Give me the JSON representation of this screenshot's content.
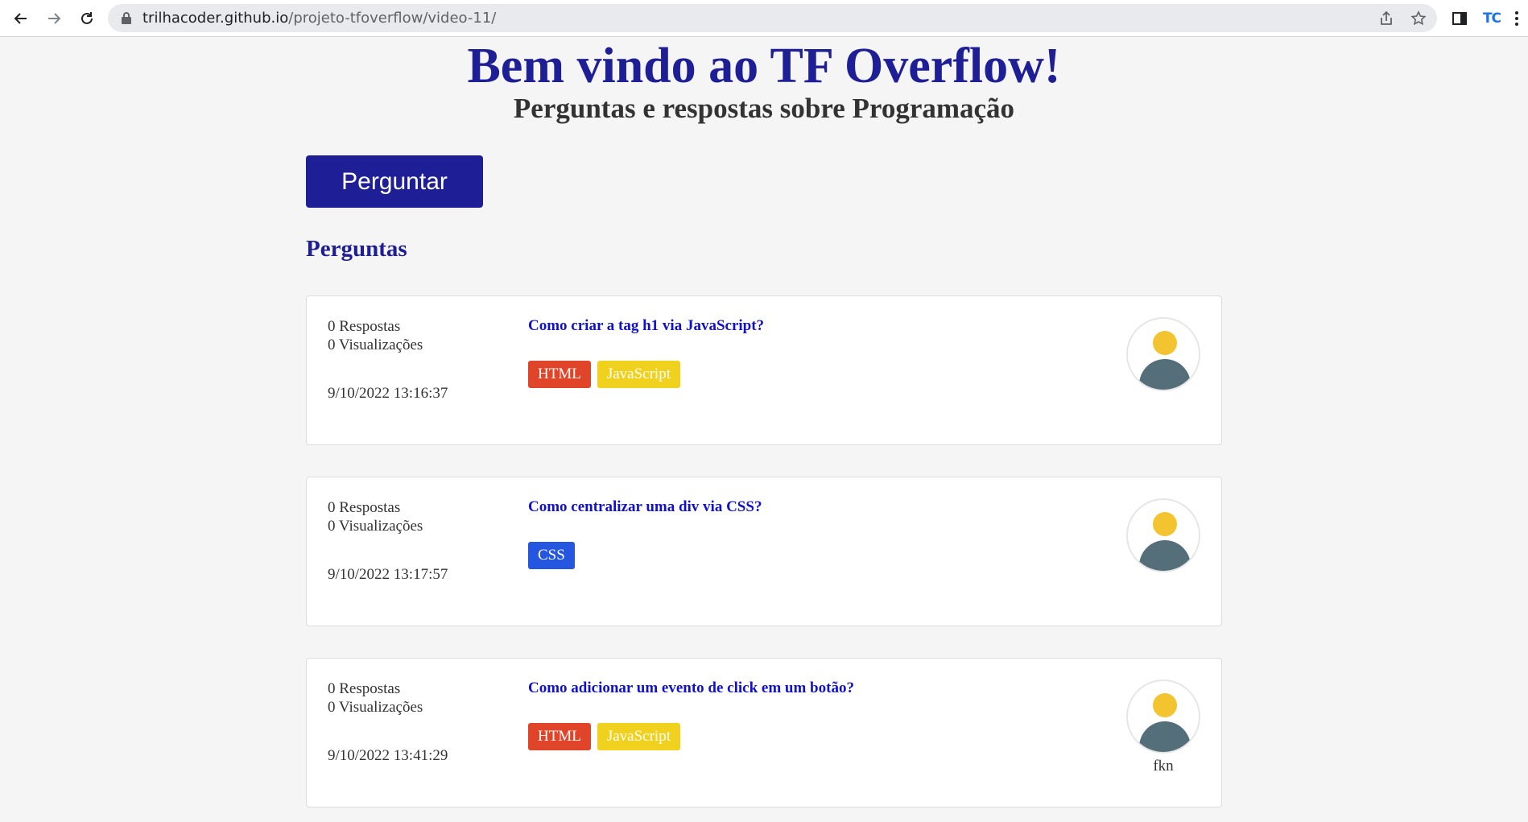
{
  "browser": {
    "url_host": "trilhacoder.github.io",
    "url_path": "/projeto-tfoverflow/video-11/",
    "extension_label": "TC"
  },
  "page": {
    "title": "Bem vindo ao TF Overflow!",
    "subtitle": "Perguntas e respostas sobre Programação",
    "ask_button": "Perguntar",
    "section_title": "Perguntas"
  },
  "colors": {
    "brand": "#1e1e96",
    "tag_html": "#e0452a",
    "tag_javascript": "#f0d21e",
    "tag_css": "#2456e0"
  },
  "questions": [
    {
      "answers": "0 Respostas",
      "views": "0 Visualizações",
      "date": "9/10/2022 13:16:37",
      "title": "Como criar a tag h1 via JavaScript?",
      "tags": [
        "HTML",
        "JavaScript"
      ],
      "username": ""
    },
    {
      "answers": "0 Respostas",
      "views": "0 Visualizações",
      "date": "9/10/2022 13:17:57",
      "title": "Como centralizar uma div via CSS?",
      "tags": [
        "CSS"
      ],
      "username": ""
    },
    {
      "answers": "0 Respostas",
      "views": "0 Visualizações",
      "date": "9/10/2022 13:41:29",
      "title": "Como adicionar um evento de click em um botão?",
      "tags": [
        "HTML",
        "JavaScript"
      ],
      "username": "fkn"
    }
  ]
}
